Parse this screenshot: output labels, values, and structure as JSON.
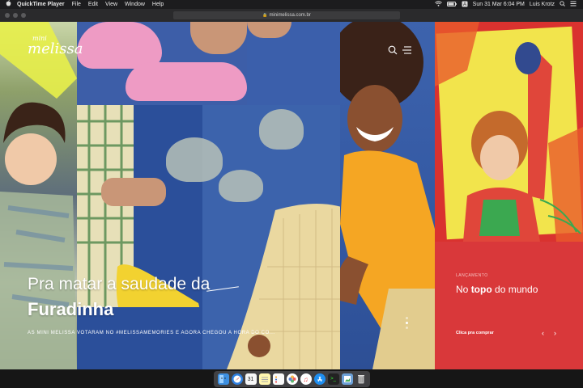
{
  "menubar": {
    "apple": "",
    "app_name": "QuickTime Player",
    "items": [
      "File",
      "Edit",
      "View",
      "Window",
      "Help"
    ],
    "datetime": "Sun 31 Mar  6:04 PM",
    "user": "Luis Krotz",
    "status_icons": [
      "wifi-icon",
      "battery-icon",
      "spotlight-icon",
      "notification-icon"
    ]
  },
  "browser": {
    "url": "minimelissa.com.br"
  },
  "site": {
    "logo_line1": "mini",
    "logo_line2": "melissa",
    "hero_title_line1": "Pra matar a saudade da",
    "hero_title_line2": "Furadinha",
    "hero_subtitle": "AS MINI MELISSA VOTARAM NO #MELISSAMEMORIES E AGORA CHEGOU A HORA DO CO...",
    "card": {
      "kicker": "LANÇAMENTO",
      "heading_pre": "No ",
      "heading_bold": "topo",
      "heading_post": " do mundo",
      "cta": "Clica pra comprar",
      "prev": "‹",
      "next": "›"
    }
  },
  "colors": {
    "accent_red": "#d9383a",
    "wall_blue": "#3c63ac",
    "shoe_pink": "#ee9bc4",
    "shoe_yellow": "#f2d230"
  },
  "dock": {
    "apps": [
      "finder-icon",
      "safari-icon",
      "calendar-icon",
      "notes-icon",
      "reminders-icon",
      "photos-icon",
      "itunes-icon",
      "appstore-icon",
      "terminal-icon",
      "preview-icon",
      "trash-icon"
    ]
  }
}
